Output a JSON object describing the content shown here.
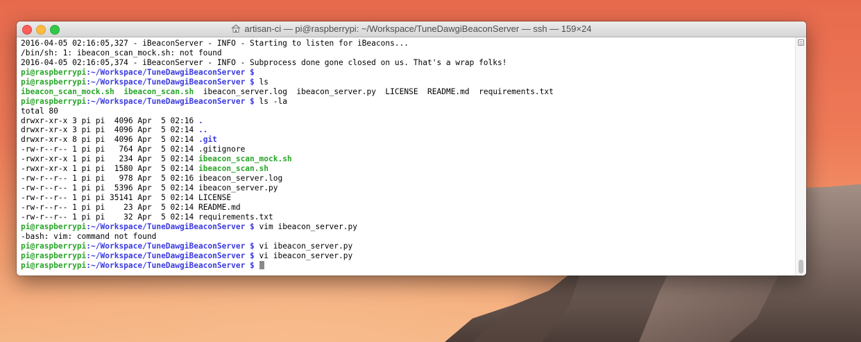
{
  "window": {
    "title": "artisan-ci — pi@raspberrypi: ~/Workspace/TuneDawgiBeaconServer — ssh — 159×24"
  },
  "prompt": {
    "user": "pi@raspberrypi",
    "path": ":~/Workspace/TuneDawgiBeaconServer $"
  },
  "terminal": {
    "log1": "2016-04-05 02:16:05,327 - iBeaconServer - INFO - Starting to listen for iBeacons...",
    "err1": "/bin/sh: 1: ibeacon_scan_mock.sh: not found",
    "log2": "2016-04-05 02:16:05,374 - iBeaconServer - INFO - Subprocess done gone closed on us. That's a wrap folks!",
    "cmd_empty": "",
    "cmd_ls": " ls",
    "ls_exec1": "ibeacon_scan_mock.sh",
    "ls_exec2": "ibeacon_scan.sh",
    "ls_rest": "  ibeacon_server.log  ibeacon_server.py  LICENSE  README.md  requirements.txt",
    "cmd_lsla": " ls -la",
    "total": "total 80",
    "entries": [
      {
        "meta": "drwxr-xr-x 3 pi pi  4096 Apr  5 02:16 ",
        "name": "."
      },
      {
        "meta": "drwxr-xr-x 3 pi pi  4096 Apr  5 02:14 ",
        "name": ".."
      },
      {
        "meta": "drwxr-xr-x 8 pi pi  4096 Apr  5 02:14 ",
        "name": ".git"
      },
      {
        "meta": "-rw-r--r-- 1 pi pi   764 Apr  5 02:14 ",
        "name": ".gitignore"
      },
      {
        "meta": "-rwxr-xr-x 1 pi pi   234 Apr  5 02:14 ",
        "name": "ibeacon_scan_mock.sh"
      },
      {
        "meta": "-rwxr-xr-x 1 pi pi  1580 Apr  5 02:14 ",
        "name": "ibeacon_scan.sh"
      },
      {
        "meta": "-rw-r--r-- 1 pi pi   978 Apr  5 02:16 ",
        "name": "ibeacon_server.log"
      },
      {
        "meta": "-rw-r--r-- 1 pi pi  5396 Apr  5 02:14 ",
        "name": "ibeacon_server.py"
      },
      {
        "meta": "-rw-r--r-- 1 pi pi 35141 Apr  5 02:14 ",
        "name": "LICENSE"
      },
      {
        "meta": "-rw-r--r-- 1 pi pi    23 Apr  5 02:14 ",
        "name": "README.md"
      },
      {
        "meta": "-rw-r--r-- 1 pi pi    32 Apr  5 02:14 ",
        "name": "requirements.txt"
      }
    ],
    "cmd_vim": " vim ibeacon_server.py",
    "err_vim": "-bash: vim: command not found",
    "cmd_vi1": " vi ibeacon_server.py",
    "cmd_vi2": " vi ibeacon_server.py"
  },
  "colors": {
    "prompt_user": "#2aa52a",
    "prompt_path": "#3b3be0",
    "directory": "#3b3be0",
    "executable": "#2aa52a"
  }
}
